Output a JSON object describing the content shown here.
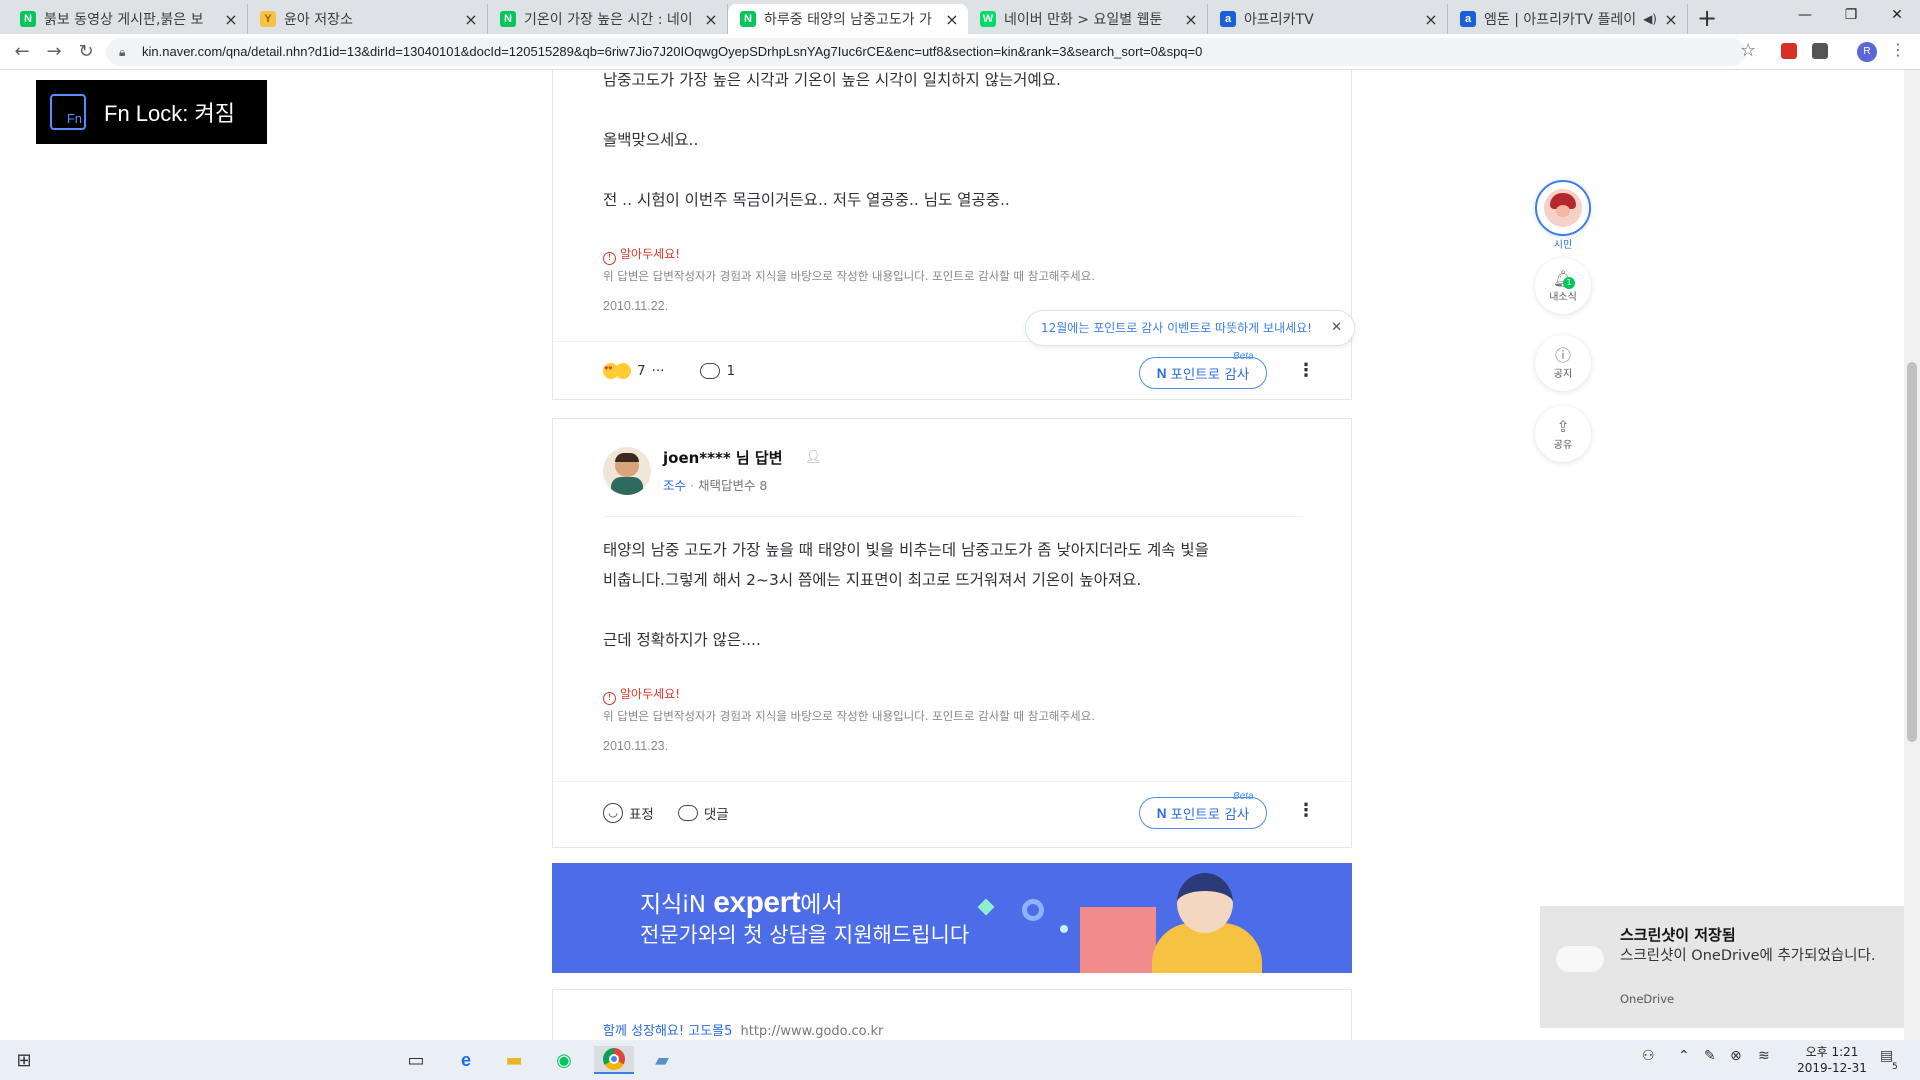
{
  "browser": {
    "tabs": [
      {
        "title": "붉보 동영상 게시판,붉은 보",
        "favicon": "naver-cafe-icon",
        "color": "#03c75a",
        "active": false
      },
      {
        "title": "윤아 저장소",
        "favicon": "y-site-icon",
        "color": "#f6c344",
        "active": false
      },
      {
        "title": "기온이 가장 높은 시간 : 네이",
        "favicon": "naver-icon",
        "color": "#03c75a",
        "active": false
      },
      {
        "title": "하루중 태양의 남중고도가 가",
        "favicon": "naver-kin-icon",
        "color": "#03c75a",
        "active": true
      },
      {
        "title": "네이버 만화 > 요일별 웹툰",
        "favicon": "naver-webtoon-icon",
        "color": "#00dc64",
        "active": false
      },
      {
        "title": "아프리카TV",
        "favicon": "afreecatv-icon",
        "color": "#1a5fd8",
        "active": false
      },
      {
        "title": "엠돈 | 아프리카TV 플레이",
        "favicon": "afreecatv-icon",
        "color": "#1a5fd8",
        "active": false
      }
    ],
    "url": "kin.naver.com/qna/detail.nhn?d1id=13&dirId=13040101&docId=120515289&qb=6riw7Jio7J20IOqwgOyepSDrhpLsnYAg7Iuc6rCE&enc=utf8&section=kin&rank=3&search_sort=0&spq=0",
    "profile_initial": "R"
  },
  "fn_lock": {
    "icon_text": "Fn",
    "label": "Fn Lock: 켜짐"
  },
  "answer1": {
    "lines": [
      "남중고도가 가장 높은 시각과 기온이 높은 시각이 일치하지 않는거예요.",
      "올백맞으세요..",
      "전 .. 시험이 이번주 목금이거든요.. 저두 열공중.. 님도 열공중.."
    ],
    "notice_title": "알아두세요!",
    "notice_body": "위 답변은 답변작성자가 경험과 지식을 바탕으로 작성한 내용입니다. 포인트로 감사할 때 참고해주세요.",
    "date": "2010.11.22.",
    "reaction_count": "7",
    "reaction_more": "···",
    "comment_count": "1",
    "point_label": "포인트로 감사",
    "beta": "Beta"
  },
  "tooltip": {
    "text": "12월에는 포인트로 감사 이벤트로 따뜻하게 보내세요!",
    "close": "✕"
  },
  "answer2": {
    "author": "joen**** 님 답변",
    "rank": "조수",
    "adopted": "채택답변수 8",
    "lines": [
      "태양의 남중 고도가 가장 높을 때 태양이 빛을 비추는데 남중고도가 좀 낮아지더라도 계속 빛을",
      "비춥니다.그렇게 해서 2~3시 쯤에는 지표면이 최고로 뜨거워져서 기온이 높아져요.",
      "근데 정확하지가 않은...."
    ],
    "notice_title": "알아두세요!",
    "notice_body": "위 답변은 답변작성자가 경험과 지식을 바탕으로 작성한 내용입니다. 포인트로 감사할 때 참고해주세요.",
    "date": "2010.11.23.",
    "reaction_label": "표정",
    "comment_label": "댓글",
    "point_label": "포인트로 감사",
    "beta": "Beta"
  },
  "side_menu": {
    "profile_label": "시민",
    "news_label": "내소식",
    "news_badge": "1",
    "notice_label": "공지",
    "share_label": "공유"
  },
  "banner": {
    "line1_prefix": "지식iN ",
    "line1_brand": "expert",
    "line1_suffix": "에서",
    "line2": "전문가와의 첫 상담을 지원해드립니다"
  },
  "ad": {
    "link_text": "함께 성장해요! 고도몰5",
    "url_text": "http://www.godo.co.kr"
  },
  "toast": {
    "title": "스크린샷이 저장됨",
    "body": "스크린샷이 OneDrive에 추가되었습니다.",
    "source": "OneDrive"
  },
  "taskbar": {
    "time": "오후 1:21",
    "date": "2019-12-31",
    "notification_count": "5"
  }
}
